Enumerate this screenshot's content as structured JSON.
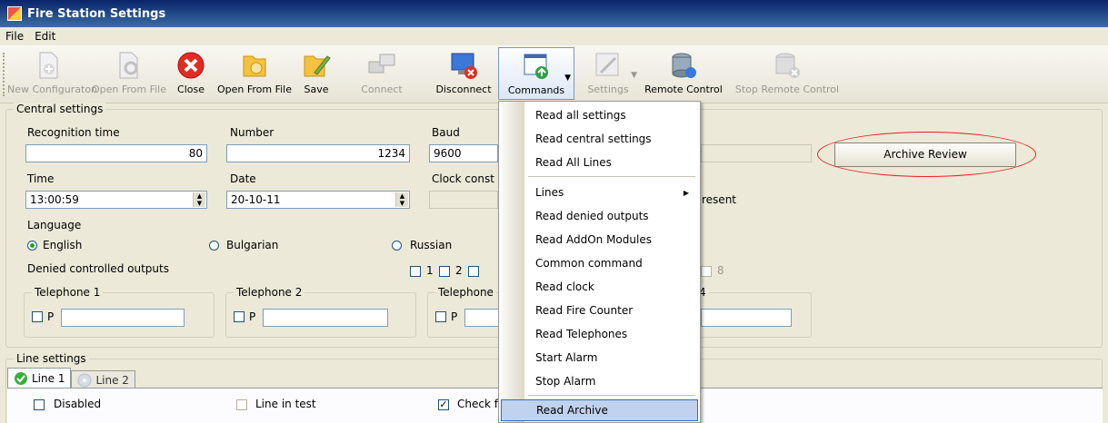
{
  "window": {
    "title": "Fire Station Settings"
  },
  "menubar": [
    "File",
    "Edit"
  ],
  "toolbar": [
    {
      "label": "New Configuraton",
      "icon": "new-configuration-icon",
      "disabled": true
    },
    {
      "label": "Open From File",
      "icon": "open-gear-icon",
      "disabled": true
    },
    {
      "label": "Close",
      "icon": "close-icon",
      "disabled": false
    },
    {
      "label": "Open From File",
      "icon": "open-folder-icon",
      "disabled": false
    },
    {
      "label": "Save",
      "icon": "save-folder-icon",
      "disabled": false
    },
    {
      "label": "Connect",
      "icon": "connect-icon",
      "disabled": true
    },
    {
      "label": "Disconnect",
      "icon": "disconnect-icon",
      "disabled": false
    },
    {
      "label": "Commands",
      "icon": "commands-icon",
      "disabled": false
    },
    {
      "label": "Settings",
      "icon": "settings-icon",
      "disabled": true
    },
    {
      "label": "Remote Control",
      "icon": "remote-control-icon",
      "disabled": false
    },
    {
      "label": "Stop Remote Control",
      "icon": "stop-remote-control-icon",
      "disabled": true
    }
  ],
  "central": {
    "title": "Central settings",
    "recognition_label": "Recognition time",
    "recognition_value": "80",
    "number_label": "Number",
    "number_value": "1234",
    "baud_label": "Baud",
    "baud_value": "9600",
    "time_label": "Time",
    "time_value": "13:00:59",
    "date_label": "Date",
    "date_value": "20-10-11",
    "clock_label": "Clock const",
    "present_fragment": "resent",
    "language_label": "Language",
    "languages": [
      "English",
      "Bulgarian",
      "Russian"
    ],
    "selected_language": "English",
    "denied_label": "Denied controlled outputs",
    "denied_outputs": [
      "1",
      "2",
      "8"
    ],
    "telephones": [
      "Telephone 1",
      "Telephone 2",
      "Telephone",
      "4"
    ],
    "phone_prefix": "P",
    "archive_button": "Archive Review"
  },
  "line_settings": {
    "title": "Line settings",
    "tabs": [
      "Line 1",
      "Line 2"
    ],
    "disabled_label": "Disabled",
    "line_in_test_label": "Line in test",
    "check_label": "Check f"
  },
  "commands_menu": [
    {
      "label": "Read all settings"
    },
    {
      "label": "Read central settings"
    },
    {
      "label": "Read All Lines"
    },
    {
      "label": "Lines",
      "submenu": true
    },
    {
      "label": "Read denied outputs"
    },
    {
      "label": "Read AddOn Modules"
    },
    {
      "label": "Common command"
    },
    {
      "label": "Read clock"
    },
    {
      "label": "Read Fire Counter"
    },
    {
      "label": "Read Telephones"
    },
    {
      "label": "Start Alarm"
    },
    {
      "label": "Stop Alarm"
    },
    {
      "label": "Read Archive",
      "highlighted": true
    }
  ],
  "colors": {
    "annotation": "#e02525",
    "highlight": "#c1d2ee",
    "titlebar": "#0a246a"
  }
}
